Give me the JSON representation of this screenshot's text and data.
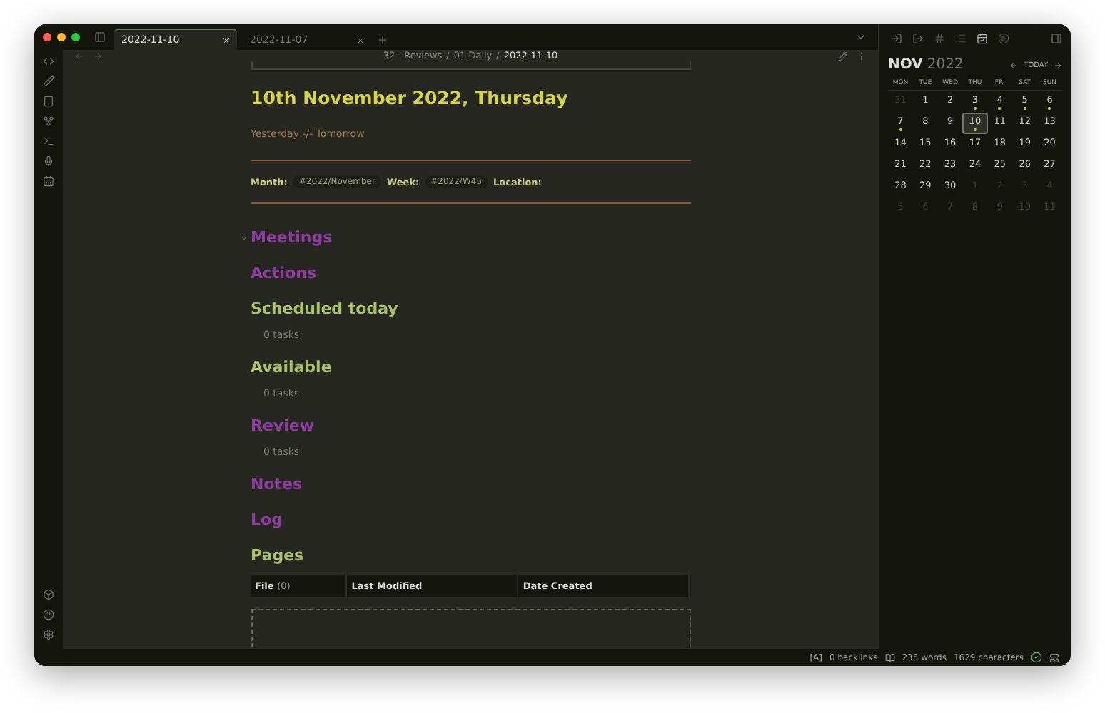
{
  "tabs": [
    {
      "label": "2022-11-10",
      "selected": true
    },
    {
      "label": "2022-11-07",
      "selected": false
    }
  ],
  "breadcrumb": [
    "32 - Reviews",
    "01 Daily",
    "2022-11-10"
  ],
  "breadcrumb_separator": "/",
  "note": {
    "title": "10th November 2022, Thursday",
    "nav_links": "Yesterday -/- Tomorrow",
    "meta": [
      {
        "label": "Month:",
        "tag": "#2022/November"
      },
      {
        "label": "Week:",
        "tag": "#2022/W45"
      },
      {
        "label": "Location:"
      }
    ],
    "sections": [
      {
        "kind": "heading",
        "text": "Meetings",
        "color": "#8f3da3",
        "expanded": true
      },
      {
        "kind": "heading",
        "text": "Actions",
        "color": "#8f3da3"
      },
      {
        "kind": "heading",
        "text": "Scheduled today",
        "color": "#a9c46a"
      },
      {
        "kind": "tasks",
        "text": "0 tasks"
      },
      {
        "kind": "heading",
        "text": "Available",
        "color": "#a9c46a"
      },
      {
        "kind": "tasks",
        "text": "0 tasks"
      },
      {
        "kind": "heading",
        "text": "Review",
        "color": "#8f3da3"
      },
      {
        "kind": "tasks",
        "text": "0 tasks"
      },
      {
        "kind": "heading",
        "text": "Notes",
        "color": "#8f3da3"
      },
      {
        "kind": "heading",
        "text": "Log",
        "color": "#8f3da3"
      },
      {
        "kind": "heading",
        "text": "Pages",
        "color": "#a9c46a"
      }
    ],
    "table": {
      "columns": [
        {
          "label": "File",
          "count": "(0)"
        },
        {
          "label": "Last Modified"
        },
        {
          "label": "Date Created"
        }
      ]
    }
  },
  "calendar": {
    "month": "NOV",
    "year": "2022",
    "today_button": "TODAY",
    "weekdays": [
      "MON",
      "TUE",
      "WED",
      "THU",
      "FRI",
      "SAT",
      "SUN"
    ],
    "weeks": [
      [
        {
          "day": "31",
          "muted": true,
          "dot": false,
          "selected": false
        },
        {
          "day": "1",
          "muted": false,
          "dot": false,
          "selected": false
        },
        {
          "day": "2",
          "muted": false,
          "dot": false,
          "selected": false
        },
        {
          "day": "3",
          "muted": false,
          "dot": true,
          "selected": false
        },
        {
          "day": "4",
          "muted": false,
          "dot": true,
          "selected": false
        },
        {
          "day": "5",
          "muted": false,
          "dot": true,
          "selected": false
        },
        {
          "day": "6",
          "muted": false,
          "dot": true,
          "selected": false
        }
      ],
      [
        {
          "day": "7",
          "muted": false,
          "dot": true,
          "selected": false
        },
        {
          "day": "8",
          "muted": false,
          "dot": false,
          "selected": false
        },
        {
          "day": "9",
          "muted": false,
          "dot": false,
          "selected": false
        },
        {
          "day": "10",
          "muted": false,
          "dot": true,
          "selected": true
        },
        {
          "day": "11",
          "muted": false,
          "dot": false,
          "selected": false
        },
        {
          "day": "12",
          "muted": false,
          "dot": false,
          "selected": false
        },
        {
          "day": "13",
          "muted": false,
          "dot": false,
          "selected": false
        }
      ],
      [
        {
          "day": "14",
          "muted": false,
          "dot": false,
          "selected": false
        },
        {
          "day": "15",
          "muted": false,
          "dot": false,
          "selected": false
        },
        {
          "day": "16",
          "muted": false,
          "dot": false,
          "selected": false
        },
        {
          "day": "17",
          "muted": false,
          "dot": false,
          "selected": false
        },
        {
          "day": "18",
          "muted": false,
          "dot": false,
          "selected": false
        },
        {
          "day": "19",
          "muted": false,
          "dot": false,
          "selected": false
        },
        {
          "day": "20",
          "muted": false,
          "dot": false,
          "selected": false
        }
      ],
      [
        {
          "day": "21",
          "muted": false,
          "dot": false,
          "selected": false
        },
        {
          "day": "22",
          "muted": false,
          "dot": false,
          "selected": false
        },
        {
          "day": "23",
          "muted": false,
          "dot": false,
          "selected": false
        },
        {
          "day": "24",
          "muted": false,
          "dot": false,
          "selected": false
        },
        {
          "day": "25",
          "muted": false,
          "dot": false,
          "selected": false
        },
        {
          "day": "26",
          "muted": false,
          "dot": false,
          "selected": false
        },
        {
          "day": "27",
          "muted": false,
          "dot": false,
          "selected": false
        }
      ],
      [
        {
          "day": "28",
          "muted": false,
          "dot": false,
          "selected": false
        },
        {
          "day": "29",
          "muted": false,
          "dot": false,
          "selected": false
        },
        {
          "day": "30",
          "muted": false,
          "dot": false,
          "selected": false
        },
        {
          "day": "1",
          "muted": true,
          "dot": false,
          "selected": false
        },
        {
          "day": "2",
          "muted": true,
          "dot": false,
          "selected": false
        },
        {
          "day": "3",
          "muted": true,
          "dot": false,
          "selected": false
        },
        {
          "day": "4",
          "muted": true,
          "dot": false,
          "selected": false
        }
      ],
      [
        {
          "day": "5",
          "muted": true,
          "dot": false,
          "selected": false
        },
        {
          "day": "6",
          "muted": true,
          "dot": false,
          "selected": false
        },
        {
          "day": "7",
          "muted": true,
          "dot": false,
          "selected": false
        },
        {
          "day": "8",
          "muted": true,
          "dot": false,
          "selected": false
        },
        {
          "day": "9",
          "muted": true,
          "dot": false,
          "selected": false
        },
        {
          "day": "10",
          "muted": true,
          "dot": false,
          "selected": false
        },
        {
          "day": "11",
          "muted": true,
          "dot": false,
          "selected": false
        }
      ]
    ]
  },
  "status_bar": {
    "mode": "[A]",
    "backlinks": "0 backlinks",
    "words": "235 words",
    "characters": "1629 characters"
  }
}
